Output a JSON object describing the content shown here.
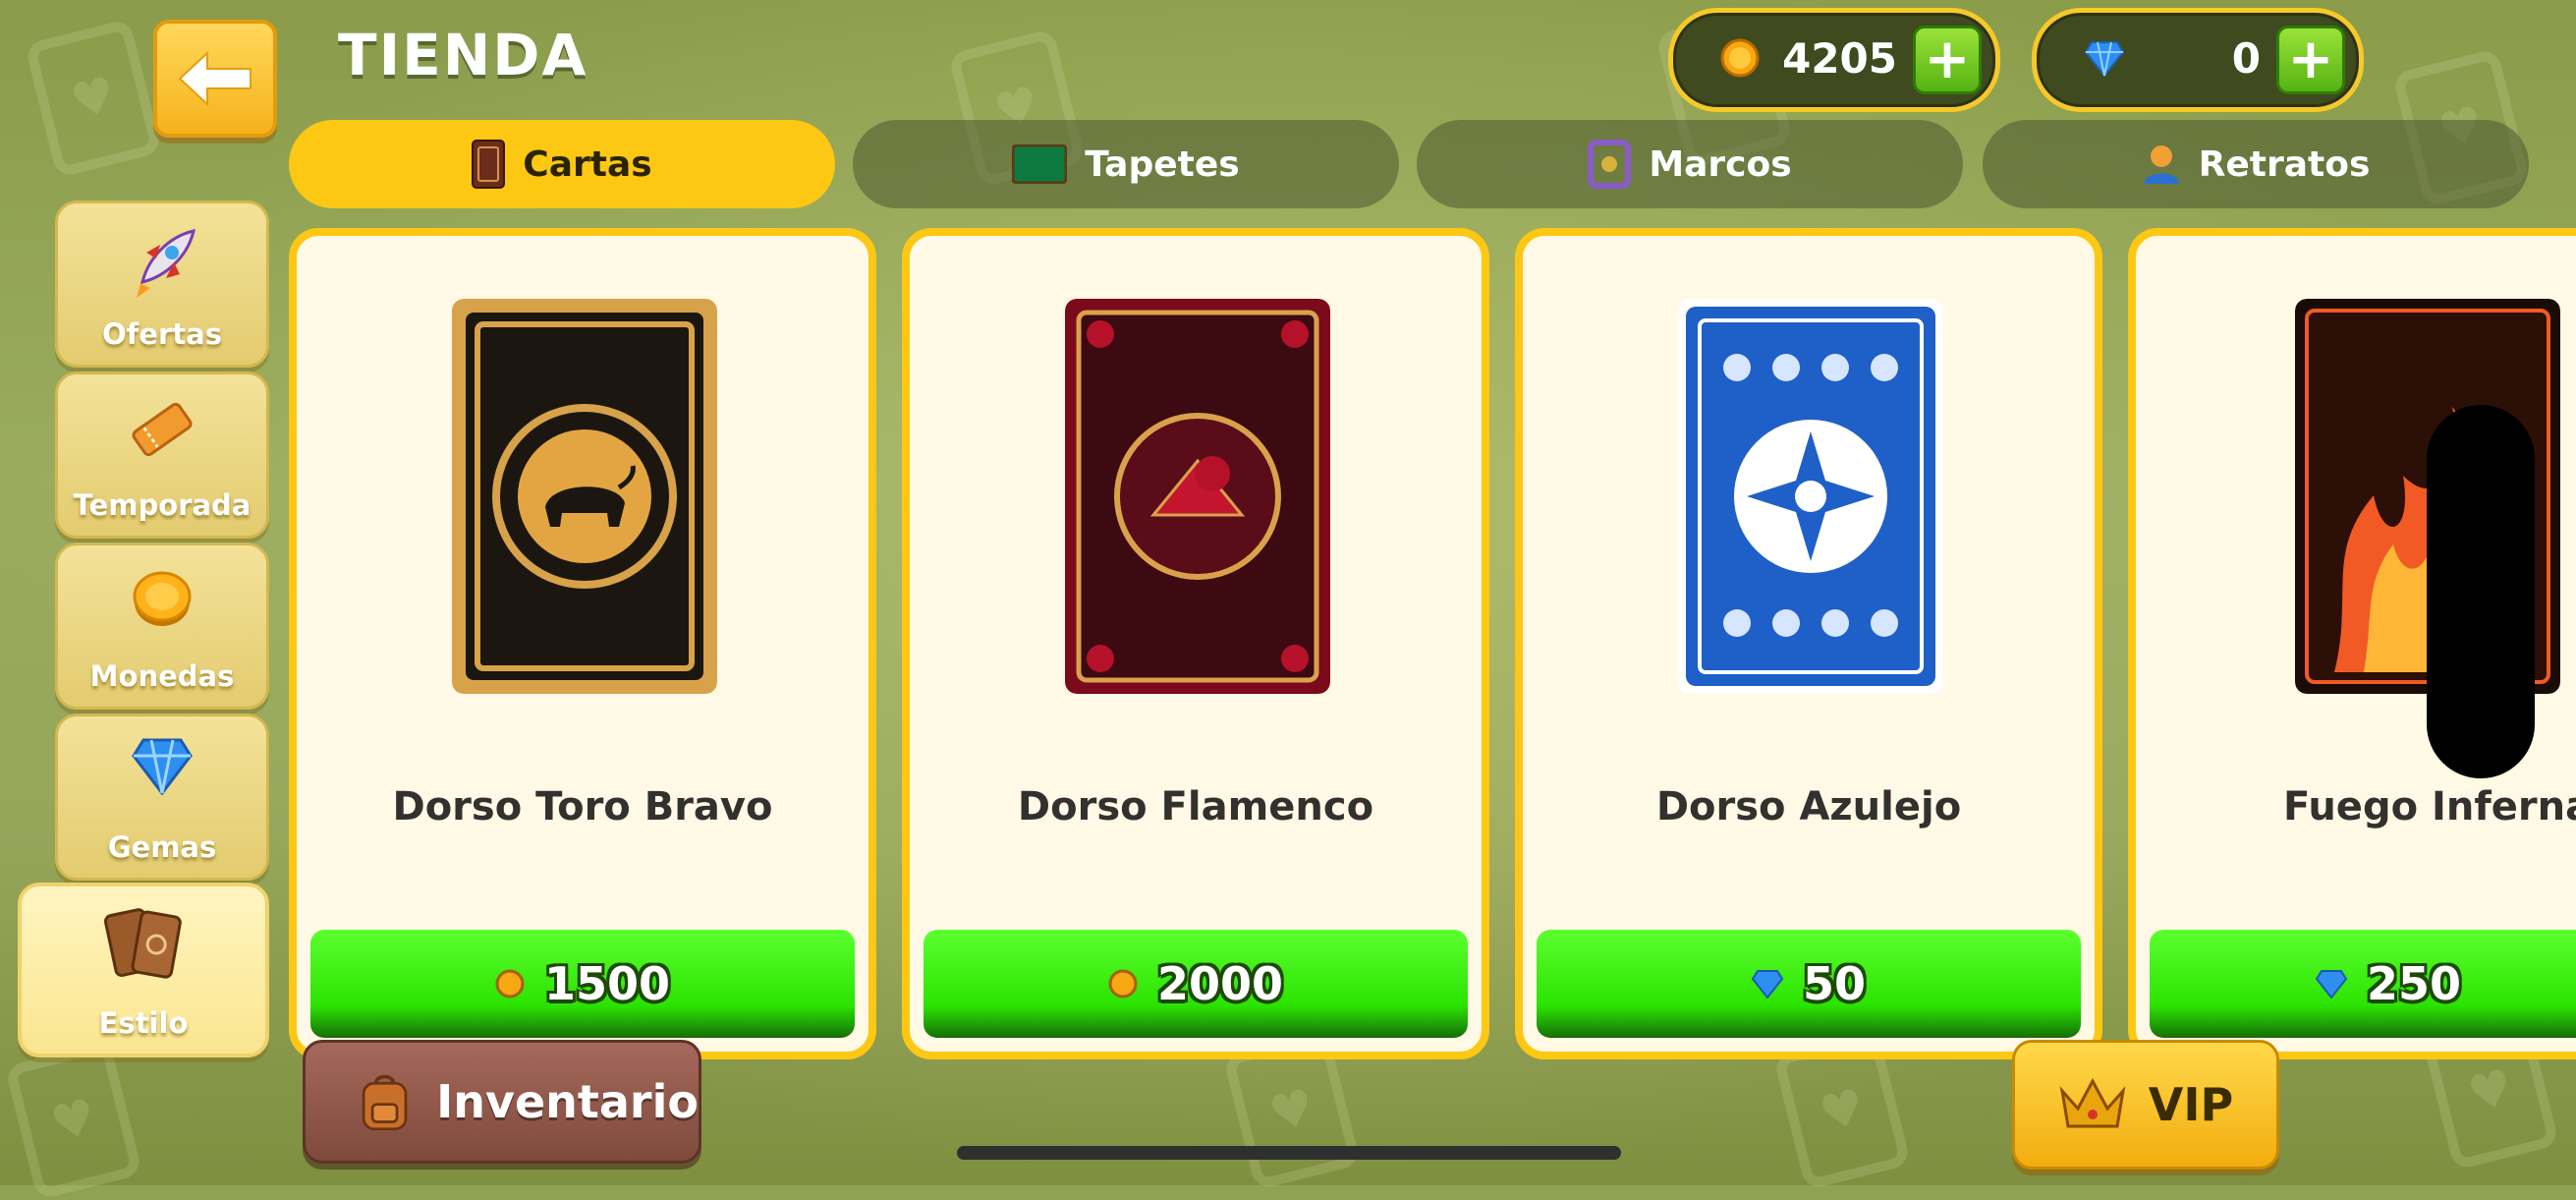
{
  "header": {
    "title": "TIENDA",
    "coins": "4205",
    "gems": "0"
  },
  "tabs": [
    {
      "label": "Cartas",
      "active": true
    },
    {
      "label": "Tapetes",
      "active": false
    },
    {
      "label": "Marcos",
      "active": false
    },
    {
      "label": "Retratos",
      "active": false
    }
  ],
  "sidebar": [
    {
      "label": "Ofertas",
      "icon": "rocket-icon"
    },
    {
      "label": "Temporada",
      "icon": "ticket-icon"
    },
    {
      "label": "Monedas",
      "icon": "coin-icon"
    },
    {
      "label": "Gemas",
      "icon": "gem-icon"
    },
    {
      "label": "Estilo",
      "icon": "cards-icon",
      "active": true
    }
  ],
  "items": [
    {
      "name": "Dorso Toro Bravo",
      "price": "1500",
      "currency": "coin-icon"
    },
    {
      "name": "Dorso Flamenco",
      "price": "2000",
      "currency": "coin-icon"
    },
    {
      "name": "Dorso Azulejo",
      "price": "50",
      "currency": "gem-icon"
    },
    {
      "name": "Fuego Infernal",
      "price": "250",
      "currency": "gem-icon"
    }
  ],
  "bottom": {
    "inventory_label": "Inventario",
    "vip_label": "VIP"
  },
  "colors": {
    "accent_yellow": "#fcc814",
    "buy_green": "#2be400",
    "background": "#8fa253"
  }
}
